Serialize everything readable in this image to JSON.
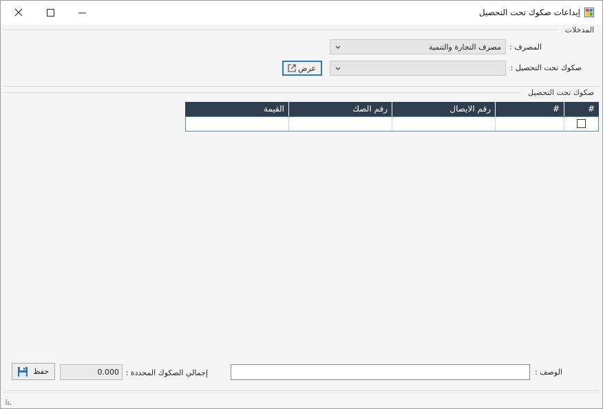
{
  "window": {
    "title": "إيداعات صكوك تحت التحصيل"
  },
  "inputs_group": {
    "label": "المدخلات",
    "bank_label": "المصرف :",
    "bank_value": "مصرف التجارة والتنمية",
    "cheques_label": "صكوك تحت التحصيل :",
    "cheques_value": "",
    "view_button": "عرض"
  },
  "cheques_group": {
    "label": "صكوك تحت التحصيل"
  },
  "grid": {
    "columns": [
      "#",
      "#",
      "رقم الايصال",
      "رقم الصك",
      "القيمة"
    ],
    "rows": [
      {
        "checked": false,
        "index": "",
        "receipt": "",
        "cheque": "",
        "value": ""
      }
    ]
  },
  "footer": {
    "description_label": "الوصف :",
    "description_value": "",
    "total_label": "إجمالي الصكوك المحددة :",
    "total_value": "0.000",
    "save_button": "حفظ"
  },
  "colors": {
    "grid_header": "#2e3d4f",
    "accent": "#2b78c8"
  }
}
